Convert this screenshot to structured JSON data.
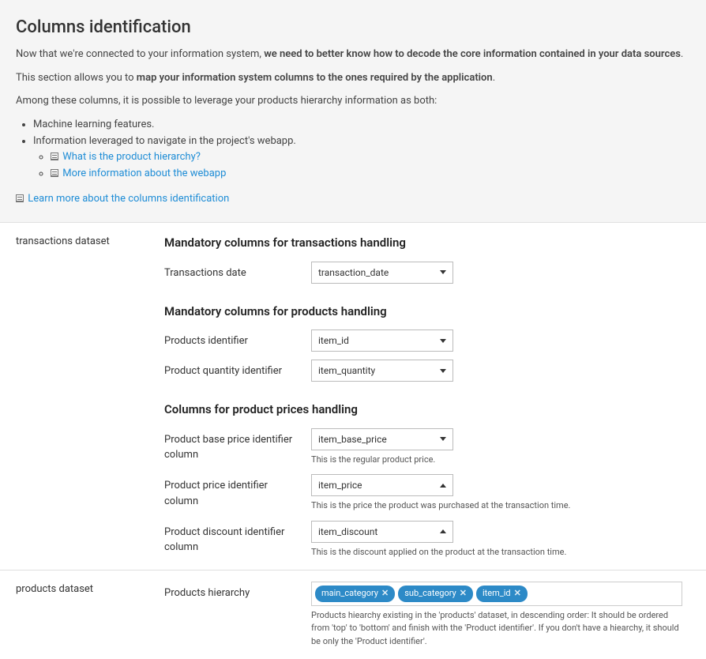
{
  "header": {
    "title": "Columns identification",
    "p1_prefix": "Now that we're connected to your information system, ",
    "p1_strong": "we need to better know how to decode the core information contained in your data sources",
    "p1_suffix": ".",
    "p2_prefix": "This section allows you to ",
    "p2_strong": "map your information system columns to the ones required by the application",
    "p2_suffix": ".",
    "p3": "Among these columns, it is possible to leverage your products hierarchy information as both:",
    "bullets": [
      "Machine learning features.",
      "Information leveraged to navigate in the project's webapp."
    ],
    "sublinks": [
      "What is the product hierarchy?",
      "More information about the webapp"
    ],
    "learn_more": "Learn more about the columns identification"
  },
  "sections": {
    "transactions": {
      "label": "transactions dataset",
      "groups": {
        "txn": {
          "title": "Mandatory columns for transactions handling",
          "date_label": "Transactions date",
          "date_value": "transaction_date"
        },
        "products": {
          "title": "Mandatory columns for products handling",
          "id_label": "Products identifier",
          "id_value": "item_id",
          "qty_label": "Product quantity identifier",
          "qty_value": "item_quantity"
        },
        "prices": {
          "title": "Columns for product prices handling",
          "base_label": "Product base price identifier column",
          "base_value": "item_base_price",
          "base_help": "This is the regular product price.",
          "price_label": "Product price identifier column",
          "price_value": "item_price",
          "price_help": "This is the price the product was purchased at the transaction time.",
          "discount_label": "Product discount identifier column",
          "discount_value": "item_discount",
          "discount_help": "This is the discount applied on the product at the transaction time."
        }
      }
    },
    "products": {
      "label": "products dataset",
      "hierarchy_label": "Products hierarchy",
      "hierarchy_tags": [
        "main_category",
        "sub_category",
        "item_id"
      ],
      "hierarchy_help": "Products hiearchy existing in the 'products' dataset, in descending order: It should be ordered from 'top' to 'bottom' and finish with the 'Product identifier'. If you don't have a hiearchy, it should be only the 'Product identifier'."
    }
  }
}
